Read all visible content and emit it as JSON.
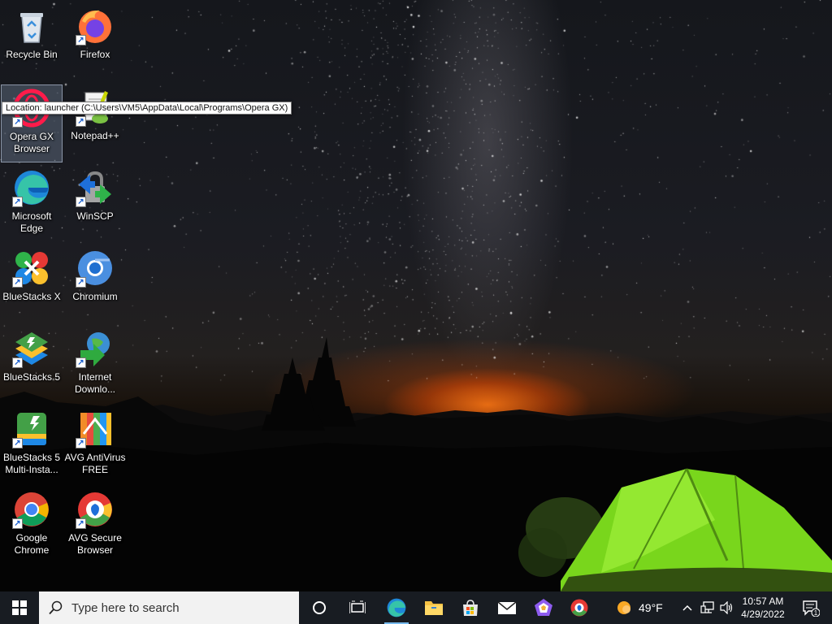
{
  "desktop": {
    "icons": [
      {
        "label": "Recycle Bin"
      },
      {
        "label": "Firefox"
      },
      {
        "label": "Opera GX Browser"
      },
      {
        "label": "Notepad++"
      },
      {
        "label": "Microsoft Edge"
      },
      {
        "label": "WinSCP"
      },
      {
        "label": "BlueStacks X"
      },
      {
        "label": "Chromium"
      },
      {
        "label": "BlueStacks 5"
      },
      {
        "label": "Internet Downlo..."
      },
      {
        "label": "BlueStacks 5 Multi-Insta..."
      },
      {
        "label": "AVG AntiVirus FREE"
      },
      {
        "label": "Google Chrome"
      },
      {
        "label": "AVG Secure Browser"
      }
    ],
    "tooltip": "Location: launcher (C:\\Users\\VM5\\AppData\\Local\\Programs\\Opera GX)"
  },
  "taskbar": {
    "search_placeholder": "Type here to search",
    "weather": {
      "temp": "49°F"
    },
    "clock": {
      "time": "10:57 AM",
      "date": "4/29/2022"
    },
    "notification_count": "1"
  },
  "colors": {
    "taskbar_bg": "#181c22",
    "active_indicator": "#76b9ed",
    "tent_green": "#7fe01e"
  }
}
